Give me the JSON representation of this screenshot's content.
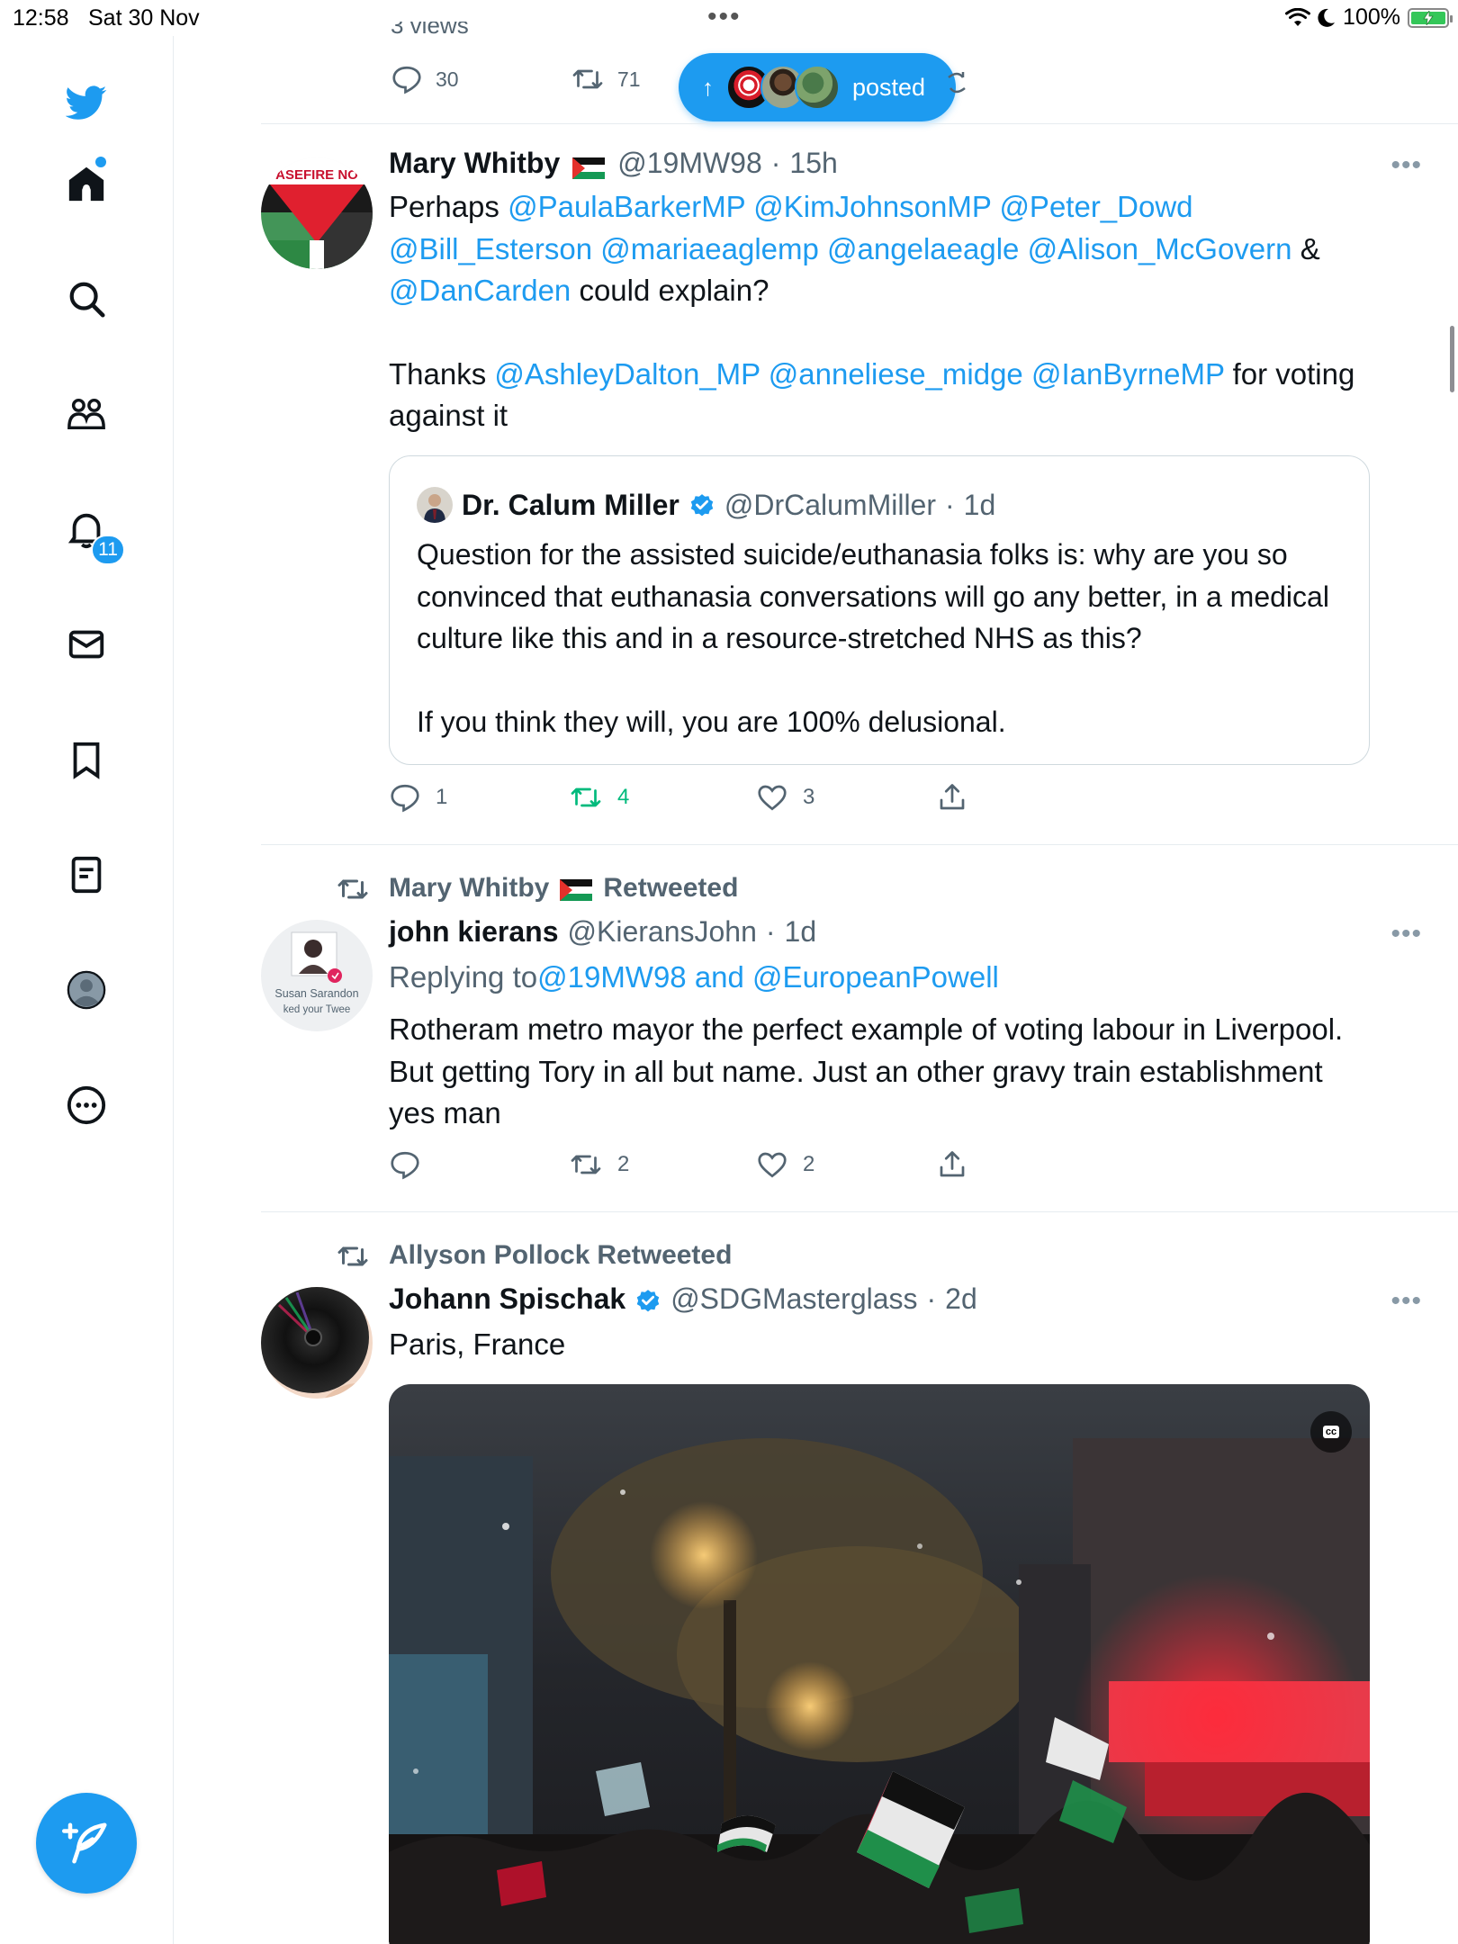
{
  "status_bar": {
    "time": "12:58",
    "date": "Sat 30 Nov",
    "battery": "100%"
  },
  "sidebar": {
    "items": [
      {
        "icon": "twitter-bird-icon"
      },
      {
        "icon": "home-icon"
      },
      {
        "icon": "search-icon"
      },
      {
        "icon": "communities-icon"
      },
      {
        "icon": "notifications-icon",
        "badge": "11"
      },
      {
        "icon": "messages-icon"
      },
      {
        "icon": "bookmarks-icon"
      },
      {
        "icon": "lists-icon"
      },
      {
        "icon": "profile-icon"
      },
      {
        "icon": "more-icon"
      }
    ],
    "compose_icon": "compose-tweet-icon"
  },
  "previous_tweet": {
    "cut_text": "3 views",
    "replies": "30",
    "retweets": "71"
  },
  "new_posts_pill": {
    "label": "posted"
  },
  "tweet1": {
    "name": "Mary Whitby",
    "handle": "@19MW98",
    "time": "15h",
    "avatar_text": "ASEFIRE NO",
    "line1_start": "Perhaps ",
    "m1": "@PaulaBarkerMP",
    "m2": "@KimJohnsonMP",
    "m3": "@Peter_Dowd",
    "m4": "@Bill_Esterson",
    "m5": "@mariaeaglemp",
    "m6": "@angelaeagle",
    "m7": "@Alison_McGovern",
    "amp": "&",
    "m8": "@DanCarden",
    "line3_end": " could explain?",
    "thanks": "Thanks ",
    "m9": "@AshleyDalton_MP",
    "m10": "@anneliese_midge",
    "m11": "@IanByrneMP",
    "voting": " for voting",
    "against": "against it",
    "quote": {
      "name": "Dr. Calum Miller",
      "handle": "@DrCalumMiller",
      "time": "1d",
      "para1": "Question for the assisted suicide/euthanasia folks is: why are you so convinced that euthanasia conversations will go any better, in a medical culture like this and in a resource-stretched NHS as this?",
      "para2": "If you think they will, you are 100% delusional."
    },
    "replies": "1",
    "retweets": "4",
    "likes": "3"
  },
  "tweet2": {
    "retweeted_by": "Mary Whitby",
    "retweeted_label": "Retweeted",
    "name": "john kierans",
    "handle": "@KieransJohn",
    "time": "1d",
    "replying_label": "Replying to ",
    "replying_to": "@19MW98 and @EuropeanPowell",
    "body": "Rotheram metro mayor the perfect example of voting labour in Liverpool. But getting Tory in all but name. Just an other gravy train establishment yes man",
    "avatar_caption1": "Susan Sarandon",
    "avatar_caption2": "ked your Twee",
    "retweets": "2",
    "likes": "2"
  },
  "tweet3": {
    "retweeted_by": "Allyson Pollock",
    "retweeted_label": "Retweeted",
    "name": "Johann Spischak",
    "handle": "@SDGMasterglass",
    "time": "2d",
    "body": "Paris, France",
    "cc_label": "cc"
  },
  "colors": {
    "accent": "#1d9bf0",
    "retweet_green": "#00ba7c",
    "secondary_text": "#536471"
  }
}
